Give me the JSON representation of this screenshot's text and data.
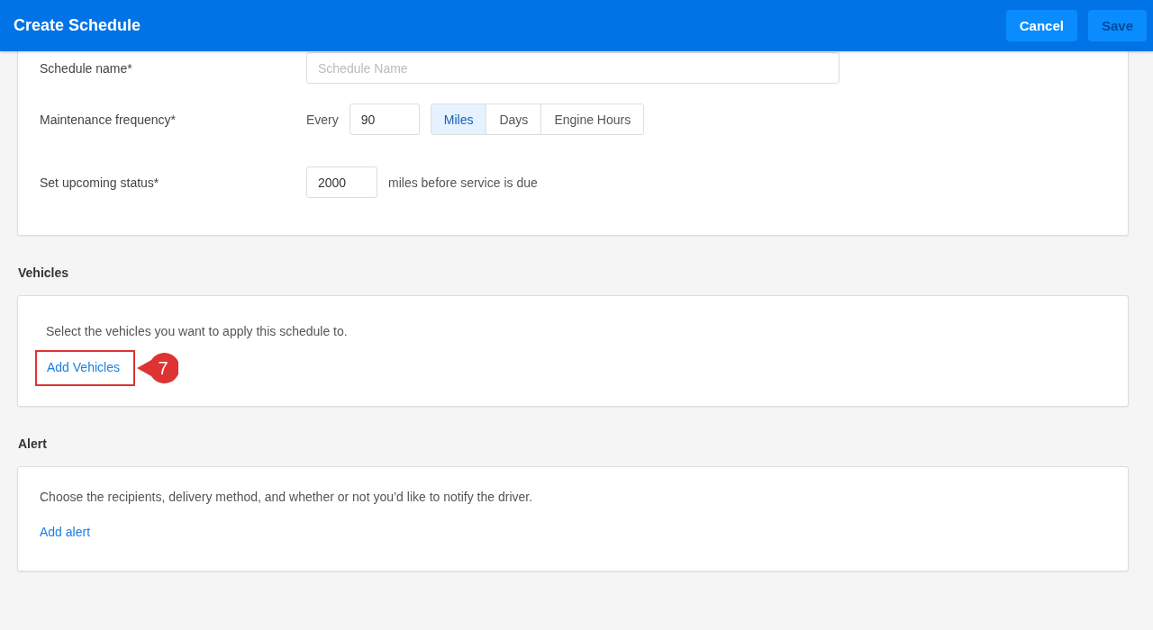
{
  "header": {
    "title": "Create Schedule",
    "buttons": [
      {
        "label": "Cancel",
        "disabled": false
      },
      {
        "label": "Save",
        "disabled": true
      }
    ]
  },
  "details": {
    "schedule_name": {
      "label": "Schedule name*",
      "placeholder": "Schedule Name"
    },
    "frequency": {
      "label": "Maintenance frequency*",
      "prefix": "Every",
      "value": "90",
      "units": [
        {
          "label": "Miles",
          "selected": true
        },
        {
          "label": "Days",
          "selected": false
        },
        {
          "label": "Engine Hours",
          "selected": false
        }
      ]
    },
    "upcoming": {
      "label": "Set upcoming status*",
      "value": "2000",
      "suffix": "miles before service is due"
    }
  },
  "vehicles": {
    "heading": "Vehicles",
    "text": "Select the vehicles you want to apply this schedule to.",
    "link": "Add Vehicles",
    "callout": "7"
  },
  "alert": {
    "heading": "Alert",
    "text": "Choose the recipients, delivery method, and whether or not you’d like to notify the driver.",
    "link": "Add alert"
  }
}
